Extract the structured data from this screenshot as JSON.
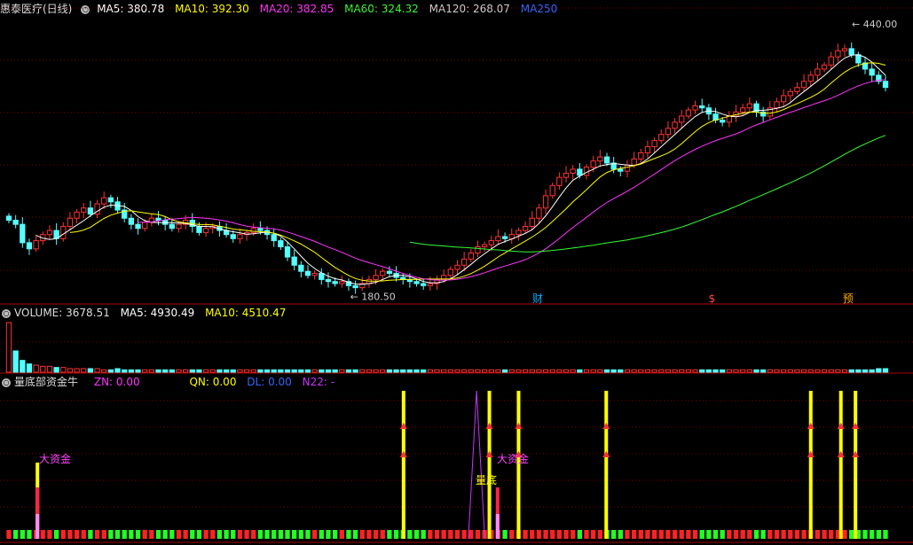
{
  "main_panel": {
    "title": "惠泰医疗(日线)",
    "ma": [
      {
        "label": "MA5: 380.78",
        "color": "#ffffff"
      },
      {
        "label": "MA10: 392.30",
        "color": "#ffff00"
      },
      {
        "label": "MA20: 382.85",
        "color": "#ff33ff"
      },
      {
        "label": "MA60: 324.32",
        "color": "#33ff33"
      },
      {
        "label": "MA120: 268.07",
        "color": "#cccccc"
      },
      {
        "label": "MA250",
        "color": "#3366ff"
      }
    ],
    "high_label": "440.00",
    "low_label": "180.50",
    "markers": [
      {
        "text": "财",
        "color": "#00aaff",
        "pos": 0.583
      },
      {
        "text": "$",
        "color": "#ff4444",
        "pos": 0.776
      },
      {
        "text": "预",
        "color": "#ffaa00",
        "pos": 0.923
      }
    ]
  },
  "volume_panel": {
    "title": "VOLUME: 3678.51",
    "ma5": "MA5: 4930.49",
    "ma10": "MA10: 4510.47"
  },
  "indicator_panel": {
    "title": "量底部资金牛",
    "zn": "ZN: 0.00",
    "qn": "QN: 0.00",
    "dl": "DL: 0.00",
    "n22": "N22: -",
    "annotations": [
      "大资金",
      "大资金",
      "量底"
    ]
  },
  "chart_data": {
    "type": "candlestick",
    "ylim": [
      175,
      450
    ],
    "close": [
      250,
      246,
      228,
      222,
      230,
      236,
      240,
      232,
      244,
      252,
      258,
      262,
      256,
      266,
      272,
      268,
      260,
      252,
      246,
      242,
      248,
      252,
      250,
      246,
      242,
      246,
      250,
      244,
      238,
      242,
      244,
      240,
      236,
      232,
      236,
      238,
      242,
      240,
      236,
      230,
      224,
      214,
      206,
      200,
      196,
      198,
      192,
      190,
      188,
      190,
      186,
      184,
      188,
      192,
      196,
      200,
      198,
      194,
      192,
      190,
      188,
      186,
      188,
      192,
      196,
      202,
      206,
      212,
      218,
      224,
      226,
      230,
      234,
      232,
      236,
      240,
      244,
      252,
      262,
      274,
      284,
      292,
      296,
      300,
      294,
      302,
      308,
      312,
      306,
      300,
      298,
      304,
      310,
      316,
      322,
      328,
      334,
      340,
      346,
      352,
      358,
      362,
      360,
      354,
      348,
      346,
      352,
      356,
      360,
      364,
      356,
      352,
      360,
      366,
      372,
      376,
      380,
      386,
      392,
      398,
      402,
      410,
      416,
      418,
      412,
      404,
      398,
      392,
      386,
      380
    ],
    "ma5_color": "#ffffff",
    "ma10_color": "#ffff00",
    "ma20_color": "#ff33ff",
    "ma60_color": "#33ff33",
    "volume": [
      42,
      18,
      10,
      7,
      6,
      5,
      5,
      4,
      4,
      3,
      3,
      3,
      3,
      3,
      2,
      2,
      3,
      2,
      2,
      2,
      2,
      2,
      2,
      2,
      2,
      2,
      2,
      2,
      2,
      2,
      2,
      2,
      2,
      2,
      2,
      2,
      2,
      2,
      2,
      2,
      2,
      2,
      2,
      2,
      2,
      2,
      2,
      2,
      2,
      2,
      2,
      2,
      2,
      2,
      2,
      2,
      2,
      2,
      2,
      2,
      2,
      2,
      2,
      2,
      2,
      2,
      2,
      2,
      2,
      2,
      2,
      2,
      2,
      2,
      2,
      2,
      2,
      2,
      2,
      2,
      2,
      2,
      2,
      2,
      2,
      2,
      2,
      2,
      2,
      2,
      2,
      2,
      2,
      2,
      2,
      2,
      2,
      2,
      2,
      2,
      2,
      2,
      2,
      2,
      2,
      2,
      2,
      2,
      2,
      2,
      2,
      2,
      2,
      2,
      2,
      2,
      2,
      2,
      2,
      2,
      2,
      2,
      2,
      2,
      2,
      2,
      2,
      2,
      3,
      3
    ],
    "signal_positions": [
      0.041,
      0.442,
      0.536,
      0.568,
      0.664,
      0.888,
      0.921,
      0.937
    ]
  }
}
